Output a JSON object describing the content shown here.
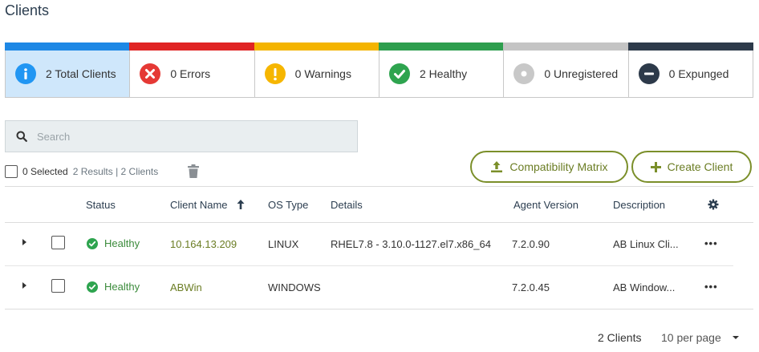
{
  "page": {
    "title": "Clients"
  },
  "summary_cards": [
    {
      "label": "2 Total Clients",
      "bar_color": "#1e88e5",
      "icon": "info-icon",
      "icon_color": "#2196f3",
      "active": true
    },
    {
      "label": "0 Errors",
      "bar_color": "#e02424",
      "icon": "error-icon",
      "icon_color": "#e53935",
      "active": false
    },
    {
      "label": "0 Warnings",
      "bar_color": "#f4b400",
      "icon": "warning-icon",
      "icon_color": "#f6b600",
      "active": false
    },
    {
      "label": "2 Healthy",
      "bar_color": "#2e9e4e",
      "icon": "check-icon",
      "icon_color": "#2ea44f",
      "active": false
    },
    {
      "label": "0 Unregistered",
      "bar_color": "#c4c4c4",
      "icon": "unregistered-icon",
      "icon_color": "#c8c8c8",
      "active": false
    },
    {
      "label": "0 Expunged",
      "bar_color": "#2d3a4a",
      "icon": "minus-icon",
      "icon_color": "#2d3a4a",
      "active": false
    }
  ],
  "search": {
    "placeholder": "Search"
  },
  "selection": {
    "selected": "0 Selected",
    "results": "2 Results | 2 Clients"
  },
  "buttons": {
    "compat": "Compatibility Matrix",
    "create": "Create Client"
  },
  "table": {
    "headers": {
      "status": "Status",
      "name": "Client Name",
      "os": "OS Type",
      "details": "Details",
      "agent": "Agent Version",
      "desc": "Description"
    },
    "sorted_column": "Client Name",
    "rows": [
      {
        "status": "Healthy",
        "name": "10.164.13.209",
        "os": "LINUX",
        "details": "RHEL7.8 - 3.10.0-1127.el7.x86_64",
        "agent": "7.2.0.90",
        "desc": "AB Linux Cli..."
      },
      {
        "status": "Healthy",
        "name": "ABWin",
        "os": "WINDOWS",
        "details": "",
        "agent": "7.2.0.45",
        "desc": "AB Window..."
      }
    ]
  },
  "footer": {
    "count": "2 Clients",
    "per_page": "10 per page"
  },
  "colors": {
    "accent": "#7b8f2a",
    "healthy": "#2ea44f"
  }
}
